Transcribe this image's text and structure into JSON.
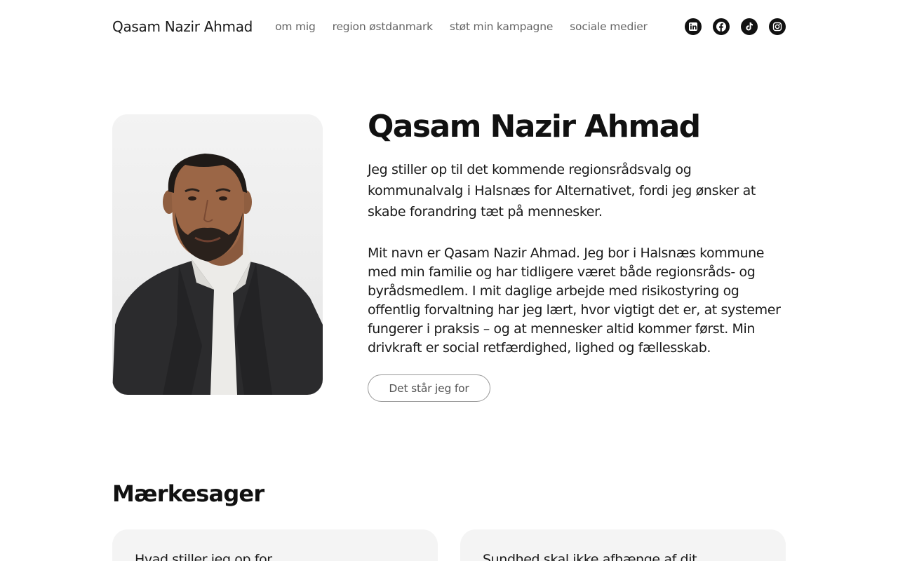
{
  "header": {
    "site_title": "Qasam Nazir Ahmad",
    "nav": [
      {
        "label": "om mig"
      },
      {
        "label": "region østdanmark"
      },
      {
        "label": "støt min kampagne"
      },
      {
        "label": "sociale medier"
      }
    ],
    "social_icons": [
      "linkedin-icon",
      "facebook-icon",
      "tiktok-icon",
      "instagram-icon"
    ]
  },
  "hero": {
    "title": "Qasam Nazir Ahmad",
    "lead": "Jeg stiller op til det kommende regionsrådsvalg og kommunalvalg i Halsnæs for Alternativet, fordi jeg ønsker at skabe forandring tæt på mennesker.",
    "body": "Mit navn er Qasam Nazir Ahmad. Jeg bor i Halsnæs kommune med min familie og har tidligere været både regionsråds- og byrådsmedlem. I mit daglige arbejde med risikostyring og offentlig forvaltning har jeg lært, hvor vigtigt det er, at systemer fungerer i praksis – og at mennesker altid kommer først. Min drivkraft er social retfærdighed, lighed og fællesskab.",
    "cta_label": "Det står jeg for"
  },
  "section": {
    "title": "Mærkesager",
    "cards": [
      {
        "title": "Hvad stiller jeg op for"
      },
      {
        "title": "Sundhed skal ikke afhænge af dit"
      }
    ]
  },
  "colors": {
    "text": "#1a1a1a",
    "nav_text": "#666666",
    "icon_bg": "#111111",
    "card_bg": "#f4f4f4",
    "button_border": "#999999"
  }
}
